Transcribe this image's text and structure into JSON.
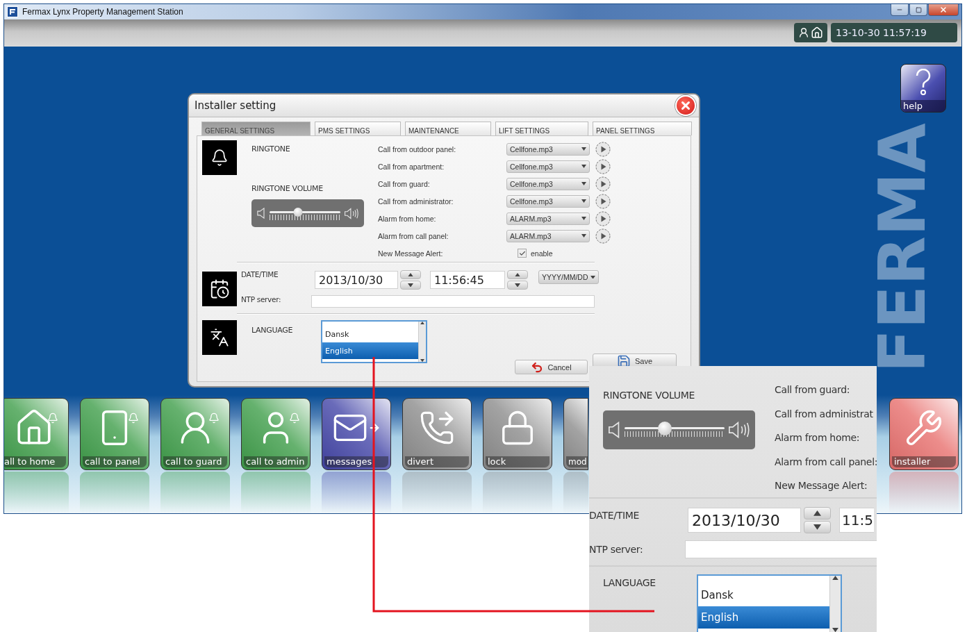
{
  "window": {
    "title": "Fermax Lynx Property Management Station"
  },
  "status": {
    "datetime": "13-10-30 11:57:19"
  },
  "help_button": {
    "label": "help"
  },
  "background_logo": "FERMA",
  "dialog": {
    "title": "Installer setting",
    "tabs": [
      {
        "label": "GENERAL SETTINGS",
        "selected": true
      },
      {
        "label": "PMS SETTINGS",
        "selected": false
      },
      {
        "label": "MAINTENANCE",
        "selected": false
      },
      {
        "label": "LIFT SETTINGS",
        "selected": false
      },
      {
        "label": "PANEL SETTINGS",
        "selected": false
      }
    ],
    "ringtone": {
      "heading": "RINGTONE",
      "volume_heading": "RINGTONE VOLUME",
      "volume": {
        "level": 0.4
      },
      "rows": [
        {
          "label": "Call from outdoor panel:",
          "value": "Cellfone.mp3"
        },
        {
          "label": "Call from apartment:",
          "value": "Cellfone.mp3"
        },
        {
          "label": "Call from guard:",
          "value": "Cellfone.mp3"
        },
        {
          "label": "Call from administrator:",
          "value": "Cellfone.mp3"
        },
        {
          "label": "Alarm from home:",
          "value": "ALARM.mp3"
        },
        {
          "label": "Alarm from call panel:",
          "value": "ALARM.mp3"
        }
      ],
      "alert": {
        "label": "New Message Alert:",
        "checkbox_label": "enable",
        "checked": true
      }
    },
    "datetime": {
      "heading": "DATE/TIME",
      "date": "2013/10/30",
      "time": "11:56:45",
      "format": "YYYY/MM/DD",
      "ntp_label": "NTP server:"
    },
    "language": {
      "heading": "LANGUAGE",
      "options": [
        {
          "label": "Dansk",
          "selected": false
        },
        {
          "label": "English",
          "selected": true
        }
      ]
    },
    "buttons": [
      {
        "kind": "cancel",
        "label": "Cancel"
      },
      {
        "kind": "save",
        "label": "Save"
      }
    ]
  },
  "tiles": [
    {
      "kind": "home",
      "label": "all to home",
      "color": "#3f9e4a"
    },
    {
      "kind": "panel",
      "label": "call to panel",
      "color": "#3f9e4a"
    },
    {
      "kind": "guard",
      "label": "call to guard",
      "color": "#3f9e4a"
    },
    {
      "kind": "admin",
      "label": "call to admin",
      "color": "#3f9e4a"
    },
    {
      "kind": "messages",
      "label": "messages",
      "color": "#4446a8"
    },
    {
      "kind": "divert",
      "label": "divert",
      "color": "#8c8c8c"
    },
    {
      "kind": "lock",
      "label": "lock",
      "color": "#8c8c8c"
    },
    {
      "kind": "mode",
      "label": "mod",
      "color": "#8c8c8c"
    },
    {
      "kind": "installer",
      "label": "installer",
      "color": "#e8706e"
    }
  ],
  "zoom_inset": {
    "volume_heading": "RINGTONE VOLUME",
    "volume": {
      "level": 0.4
    },
    "labels": [
      "Call from guard:",
      "Call from administrat",
      "Alarm from home:",
      "Alarm from call panel:",
      "New Message Alert:"
    ],
    "date_heading": "DATE/TIME",
    "date": "2013/10/30",
    "time": "11:5",
    "ntp_label": "NTP server:",
    "language_heading": "LANGUAGE",
    "languages": [
      {
        "label": "Dansk",
        "selected": false
      },
      {
        "label": "English",
        "selected": true
      }
    ]
  }
}
